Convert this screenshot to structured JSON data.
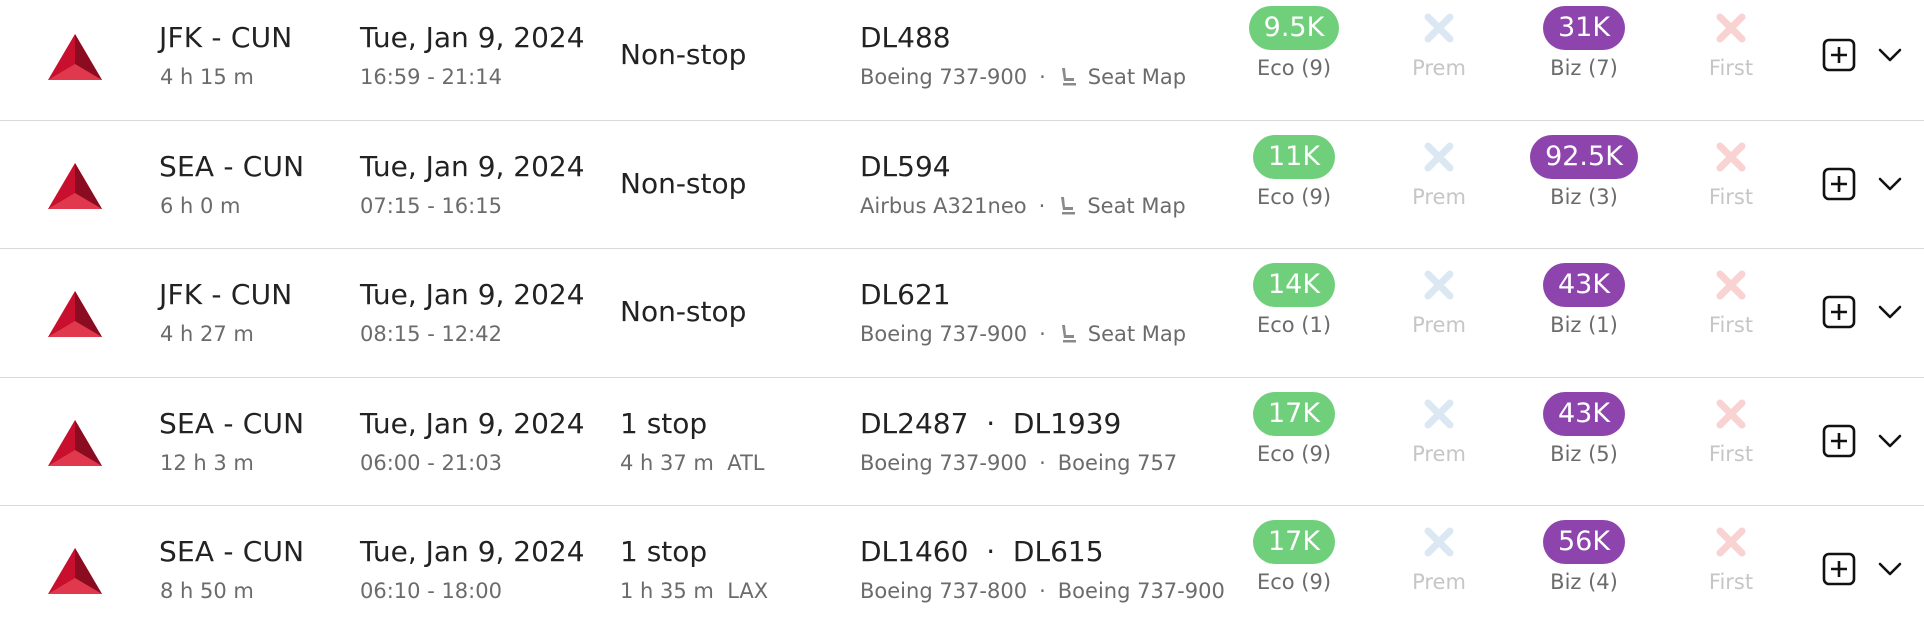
{
  "colors": {
    "eco": "#6fcf7a",
    "biz": "#8e44ad",
    "prem_x": "#dbe8f4",
    "first_x": "#f9d2d2"
  },
  "icons": {
    "airline": "delta-logo-icon",
    "seat": "seat-icon",
    "unavailable": "x-icon",
    "add": "add-box-icon",
    "expand": "chevron-down-icon"
  },
  "rows": [
    {
      "route": "JFK - CUN",
      "duration": "4 h 15 m",
      "date": "Tue, Jan 9, 2024",
      "times": "16:59 - 21:14",
      "stops": "Non-stop",
      "layover": "",
      "flights": "DL488",
      "aircraft1": "Boeing 737-900",
      "aircraft2": "",
      "seatmap": "Seat Map",
      "eco_price": "9.5K",
      "eco_label": "Eco (9)",
      "prem_label": "Prem",
      "biz_price": "31K",
      "biz_label": "Biz (7)",
      "first_label": "First"
    },
    {
      "route": "SEA - CUN",
      "duration": "6 h 0 m",
      "date": "Tue, Jan 9, 2024",
      "times": "07:15 - 16:15",
      "stops": "Non-stop",
      "layover": "",
      "flights": "DL594",
      "aircraft1": "Airbus A321neo",
      "aircraft2": "",
      "seatmap": "Seat Map",
      "eco_price": "11K",
      "eco_label": "Eco (9)",
      "prem_label": "Prem",
      "biz_price": "92.5K",
      "biz_label": "Biz (3)",
      "first_label": "First"
    },
    {
      "route": "JFK - CUN",
      "duration": "4 h 27 m",
      "date": "Tue, Jan 9, 2024",
      "times": "08:15 - 12:42",
      "stops": "Non-stop",
      "layover": "",
      "flights": "DL621",
      "aircraft1": "Boeing 737-900",
      "aircraft2": "",
      "seatmap": "Seat Map",
      "eco_price": "14K",
      "eco_label": "Eco (1)",
      "prem_label": "Prem",
      "biz_price": "43K",
      "biz_label": "Biz (1)",
      "first_label": "First"
    },
    {
      "route": "SEA - CUN",
      "duration": "12 h 3 m",
      "date": "Tue, Jan 9, 2024",
      "times": "06:00 - 21:03",
      "stops": "1 stop",
      "layover": "4 h 37 m  ATL",
      "flights": "DL2487  ·  DL1939",
      "aircraft1": "Boeing 737-900",
      "aircraft2": "Boeing 757",
      "seatmap": "",
      "eco_price": "17K",
      "eco_label": "Eco (9)",
      "prem_label": "Prem",
      "biz_price": "43K",
      "biz_label": "Biz (5)",
      "first_label": "First"
    },
    {
      "route": "SEA - CUN",
      "duration": "8 h 50 m",
      "date": "Tue, Jan 9, 2024",
      "times": "06:10 - 18:00",
      "stops": "1 stop",
      "layover": "1 h 35 m  LAX",
      "flights": "DL1460  ·  DL615",
      "aircraft1": "Boeing 737-800",
      "aircraft2": "Boeing 737-900",
      "seatmap": "",
      "eco_price": "17K",
      "eco_label": "Eco (9)",
      "prem_label": "Prem",
      "biz_price": "56K",
      "biz_label": "Biz (4)",
      "first_label": "First"
    }
  ]
}
